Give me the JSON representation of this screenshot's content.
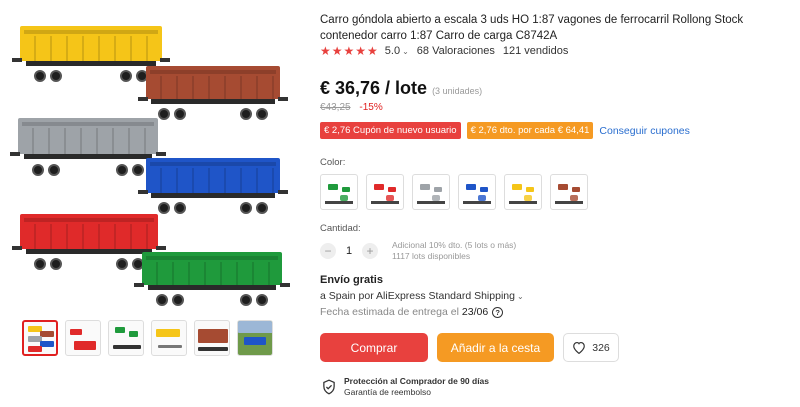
{
  "product": {
    "title": "Carro góndola abierto a escala 3 uds HO 1:87 vagones de ferrocarril Rollong Stock contenedor carro 1:87 Carro de carga C8742A",
    "rating": {
      "stars": "★★★★★",
      "value": "5.0",
      "reviews": "68 Valoraciones",
      "sold": "121 vendidos"
    },
    "price": "€ 36,76 / lote",
    "units": "(3 unidades)",
    "old_price": "€43,25",
    "discount": "-15%",
    "coupons": [
      {
        "label": "€ 2,76 Cupón de nuevo usuario",
        "color": "#e8413e"
      },
      {
        "label": "€ 2,76 dto. por cada € 64,41",
        "color": "#f59a23"
      }
    ],
    "coupon_link": "Conseguir cupones"
  },
  "gallery": {
    "wagon_colors": [
      "#f5c518",
      "#a64b32",
      "#9ea3a8",
      "#1f55c8",
      "#e02a2a",
      "#1f9a3c"
    ]
  },
  "color": {
    "label": "Color:",
    "options": [
      {
        "name": "green",
        "hex": "#1f9a3c"
      },
      {
        "name": "red",
        "hex": "#e02a2a"
      },
      {
        "name": "gray",
        "hex": "#9ea3a8"
      },
      {
        "name": "blue",
        "hex": "#1f55c8"
      },
      {
        "name": "yellow",
        "hex": "#f5c518"
      },
      {
        "name": "brown",
        "hex": "#a64b32"
      }
    ]
  },
  "quantity": {
    "label": "Cantidad:",
    "value": "1",
    "note_line1": "Adicional 10% dto. (5 lots o más)",
    "note_line2": "1117 lots disponibles"
  },
  "shipping": {
    "title": "Envío gratis",
    "line": "a Spain por AliExpress Standard Shipping",
    "delivery_label": "Fecha estimada de entrega el",
    "delivery_date": "23/06"
  },
  "actions": {
    "buy": "Comprar",
    "cart": "Añadir a la cesta",
    "wishlist_count": "326"
  },
  "protection": {
    "title": "Protección al Comprador de 90 días",
    "subtitle": "Garantía de reembolso"
  }
}
